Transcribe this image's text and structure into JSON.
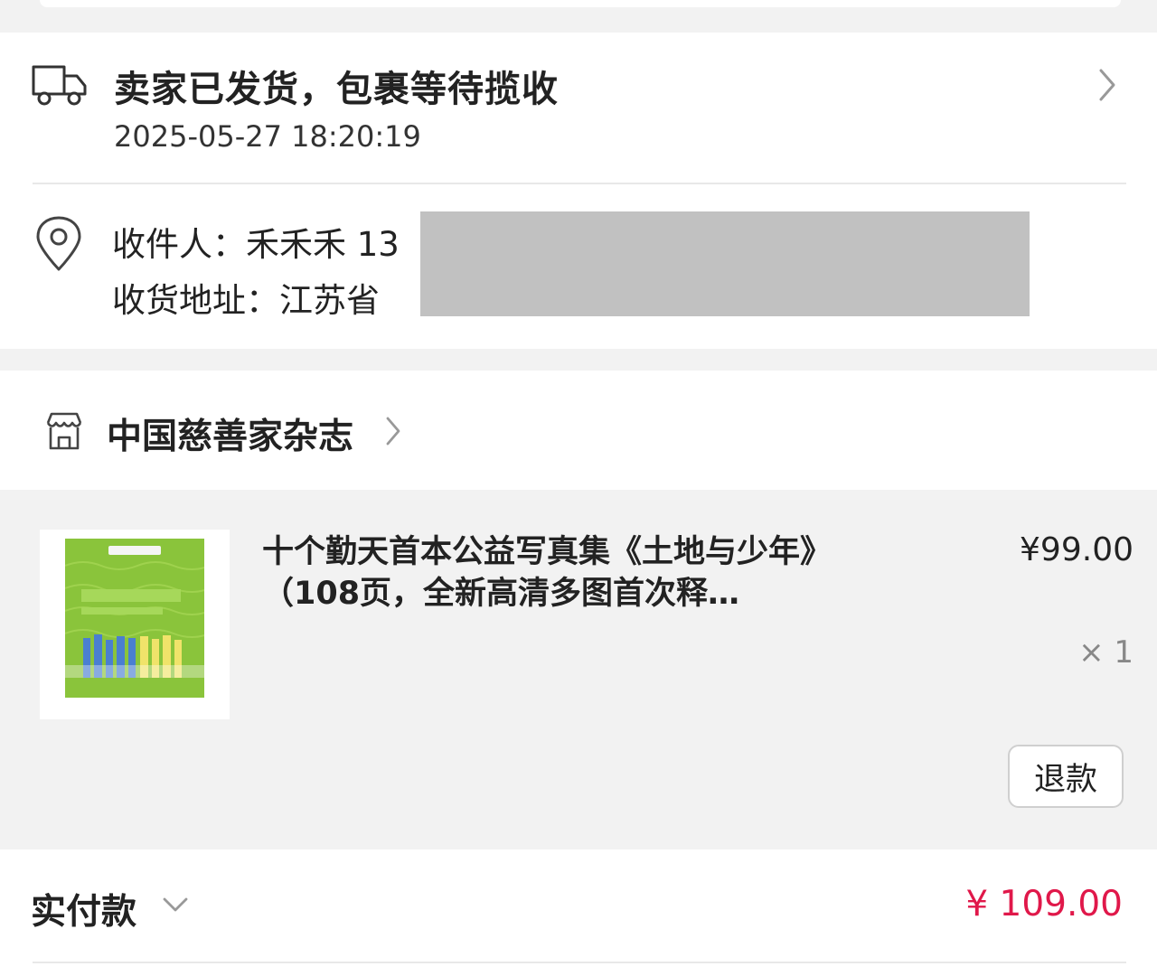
{
  "shipping": {
    "status": "卖家已发货，包裹等待揽收",
    "time": "2025-05-27 18:20:19"
  },
  "address": {
    "recipient": "收件人：禾禾禾  13",
    "address": "收货地址：江苏省"
  },
  "shop": {
    "name": "中国慈善家杂志"
  },
  "item": {
    "title": "十个勤天首本公益写真集《土地与少年》（108页，全新高清多图首次释…",
    "price": "¥99.00",
    "quantity": "× 1",
    "refund_label": "退款"
  },
  "payment": {
    "label": "实付款",
    "amount": "¥ 109.00"
  },
  "colors": {
    "accent_price": "#e0184a",
    "background": "#f2f2f2",
    "card": "#ffffff"
  }
}
